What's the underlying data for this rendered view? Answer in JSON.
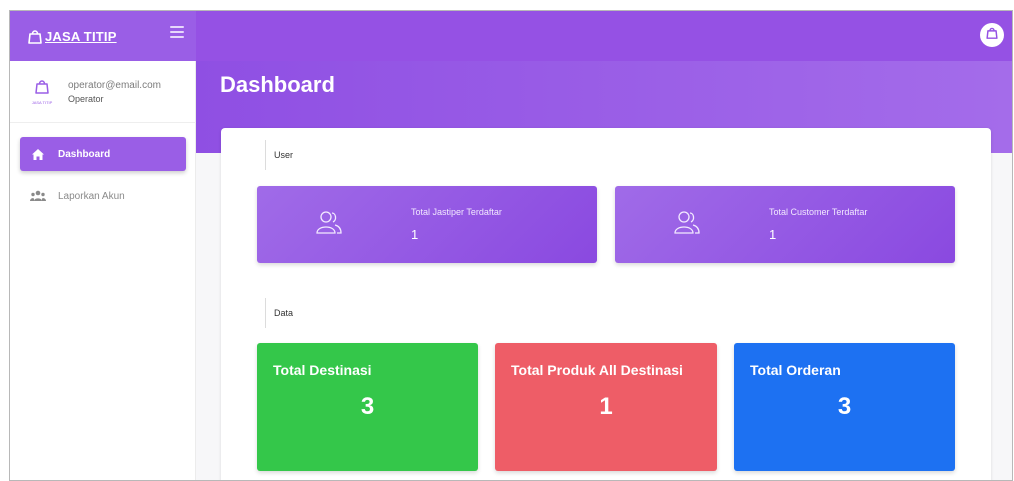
{
  "brand": {
    "name": "JASA TITIP",
    "logo_icon": "shopping-bag-icon"
  },
  "user": {
    "email": "operator@email.com",
    "role": "Operator",
    "avatar_caption": "JASA TITIP"
  },
  "nav": [
    {
      "label": "Dashboard",
      "icon": "home-icon",
      "active": true
    },
    {
      "label": "Laporkan Akun",
      "icon": "users-icon",
      "active": false
    }
  ],
  "header": {
    "title": "Dashboard"
  },
  "sections": {
    "user": "User",
    "data": "Data"
  },
  "user_stats": [
    {
      "title": "Total Jastiper Terdaftar",
      "value": "1",
      "icon": "users-icon"
    },
    {
      "title": "Total Customer Terdaftar",
      "value": "1",
      "icon": "users-icon"
    }
  ],
  "data_stats": [
    {
      "title": "Total Destinasi",
      "value": "3",
      "color": "#34c74a"
    },
    {
      "title": "Total Produk All Destinasi",
      "value": "1",
      "color": "#ee5d67"
    },
    {
      "title": "Total Orderan",
      "value": "3",
      "color": "#1d71f2"
    }
  ],
  "colors": {
    "primary": "#9551e4",
    "accent": "#9a5ee6"
  }
}
